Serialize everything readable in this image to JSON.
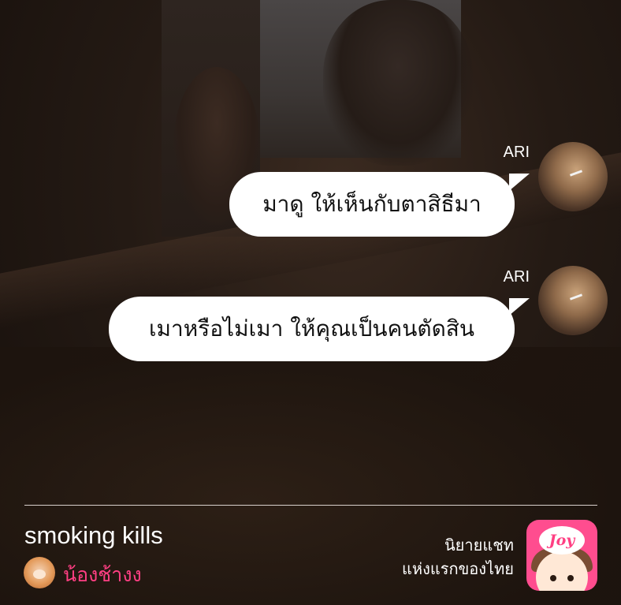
{
  "messages": [
    {
      "sender": "ARI",
      "text": "มาดู ให้เห็นกับตาสิธีมา"
    },
    {
      "sender": "ARI",
      "text": "เมาหรือไม่เมา ให้คุณเป็นคนตัดสิน"
    }
  ],
  "footer": {
    "story_title": "smoking kills",
    "author_name": "น้องช้างง",
    "tagline_line1": "นิยายแชท",
    "tagline_line2": "แห่งแรกของไทย",
    "logo_text": "Joy"
  },
  "colors": {
    "bubble": "#ffffff",
    "author_name": "#ff3f83",
    "logo_background": "#ff4d8f"
  },
  "icons": {
    "sender_avatar": "character-avatar",
    "author_avatar": "author-avatar",
    "app_logo": "joy-app-logo"
  }
}
